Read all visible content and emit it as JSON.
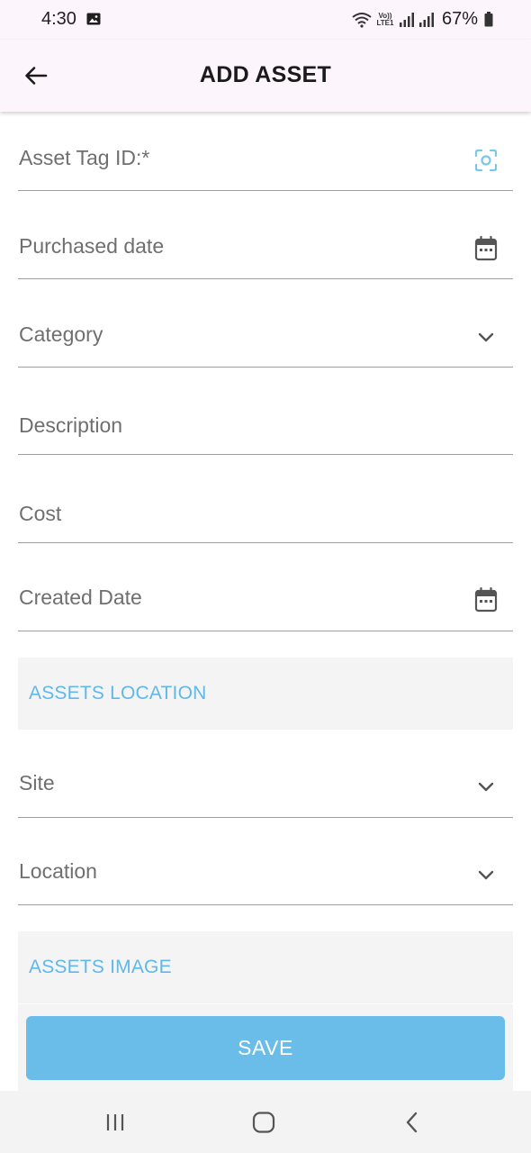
{
  "status_bar": {
    "time": "4:30",
    "volte_label": "Vo)) LTE1",
    "battery": "67%"
  },
  "app_bar": {
    "title": "ADD ASSET",
    "back_icon": "arrow-left-icon"
  },
  "form": {
    "fields": [
      {
        "label": "Asset Tag ID:*",
        "icon": "scan-icon"
      },
      {
        "label": "Purchased date",
        "icon": "calendar-icon"
      },
      {
        "label": "Category",
        "icon": "chevron-down-icon"
      },
      {
        "label": "Description"
      },
      {
        "label": "Cost"
      },
      {
        "label": "Created Date",
        "icon": "calendar-icon"
      }
    ],
    "location_section": {
      "title": "ASSETS LOCATION",
      "fields": [
        {
          "label": "Site",
          "icon": "chevron-down-icon"
        },
        {
          "label": "Location",
          "icon": "chevron-down-icon"
        }
      ]
    },
    "image_section": {
      "title": "ASSETS IMAGE"
    },
    "save_label": "SAVE"
  },
  "nav_bar": {
    "items": [
      "recent-apps-icon",
      "home-icon",
      "back-chevron-icon"
    ]
  },
  "colors": {
    "accent": "#6bbde9",
    "section_text": "#5fb8e8",
    "app_bar_bg": "#fdf5fc",
    "section_bg": "#f4f4f4"
  }
}
